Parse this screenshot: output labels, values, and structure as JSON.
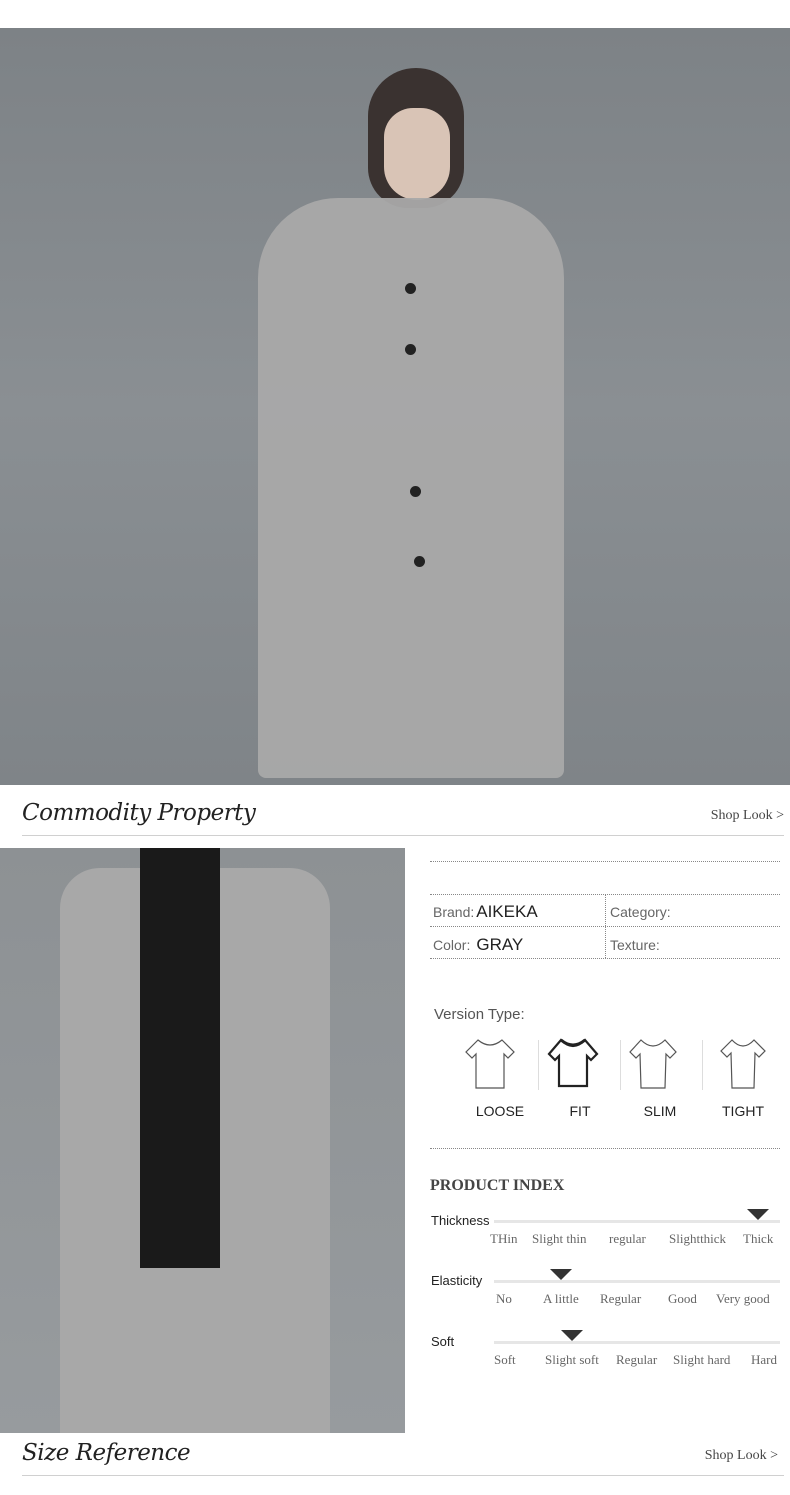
{
  "sections": {
    "commodity_property": {
      "title": "Commodity Property",
      "shop_look": "Shop Look >"
    },
    "size_reference": {
      "title": "Size Reference",
      "shop_look": "Shop Look >"
    }
  },
  "properties": {
    "brand_label": "Brand:",
    "brand_value": "AIKEKA",
    "category_label": "Category:",
    "category_value": "",
    "color_label": "Color:",
    "color_value": "GRAY",
    "texture_label": "Texture:",
    "texture_value": ""
  },
  "version_type": {
    "label": "Version Type:",
    "options": [
      "LOOSE",
      "FIT",
      "SLIM",
      "TIGHT"
    ],
    "selected": "FIT"
  },
  "product_index": {
    "title": "PRODUCT INDEX",
    "scales": [
      {
        "label": "Thickness",
        "options": [
          "THin",
          "Slight thin",
          "regular",
          "Slightthick",
          "Thick"
        ],
        "selected_index": 4
      },
      {
        "label": "Elasticity",
        "options": [
          "No",
          "A little",
          "Regular",
          "Good",
          "Very good"
        ],
        "selected_index": 1
      },
      {
        "label": "Soft",
        "options": [
          "Soft",
          "Slight soft",
          "Regular",
          "Slight hard",
          "Hard"
        ],
        "selected_index": 1
      }
    ]
  },
  "colors": {
    "marker": "#333333",
    "bar": "#e6e6e6",
    "background": "#ffffff"
  }
}
